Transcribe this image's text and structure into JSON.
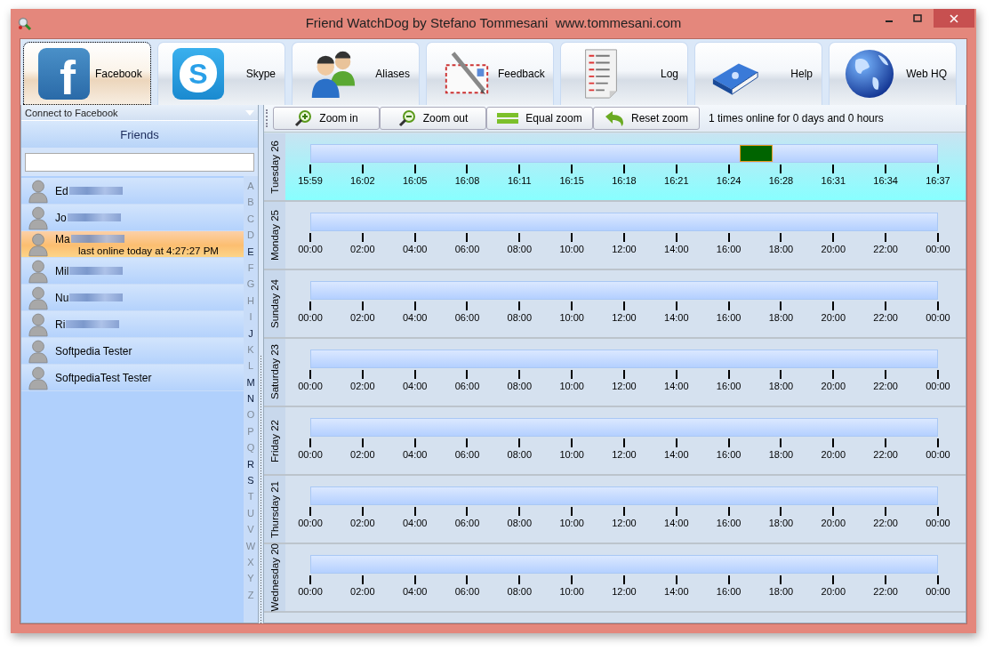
{
  "window": {
    "title": "Friend WatchDog by Stefano Tommesani  www.tommesani.com"
  },
  "tabs": [
    {
      "label": "Facebook",
      "kind": "facebook",
      "glyph": "f",
      "selected": true
    },
    {
      "label": "Skype",
      "kind": "skype",
      "glyph": "S",
      "selected": false
    },
    {
      "label": "Aliases",
      "kind": "people",
      "selected": false
    },
    {
      "label": "Feedback",
      "kind": "letter",
      "selected": false
    },
    {
      "label": "Log",
      "kind": "log",
      "selected": false
    },
    {
      "label": "Help",
      "kind": "book",
      "selected": false
    },
    {
      "label": "Web HQ",
      "kind": "globe",
      "selected": false
    }
  ],
  "left_panel": {
    "connect": "Connect to Facebook",
    "header": "Friends",
    "friends": [
      {
        "name": "Ed",
        "redacted": true,
        "selected": false
      },
      {
        "name": "Jo",
        "redacted": true,
        "selected": false
      },
      {
        "name": "Ma",
        "redacted": true,
        "selected": true,
        "status": "last online today at 4:27:27 PM"
      },
      {
        "name": "Mil",
        "redacted": true,
        "selected": false
      },
      {
        "name": "Nu",
        "redacted": true,
        "selected": false
      },
      {
        "name": "Ri",
        "redacted": true,
        "selected": false
      },
      {
        "name": "Softpedia Tester",
        "redacted": false,
        "selected": false
      },
      {
        "name": "SoftpediaTest Tester",
        "redacted": false,
        "selected": false
      }
    ],
    "index": [
      {
        "letter": "A",
        "active": false
      },
      {
        "letter": "B",
        "active": false
      },
      {
        "letter": "C",
        "active": false
      },
      {
        "letter": "D",
        "active": false
      },
      {
        "letter": "E",
        "active": true
      },
      {
        "letter": "F",
        "active": false
      },
      {
        "letter": "G",
        "active": false
      },
      {
        "letter": "H",
        "active": false
      },
      {
        "letter": "I",
        "active": false
      },
      {
        "letter": "J",
        "active": true
      },
      {
        "letter": "K",
        "active": false
      },
      {
        "letter": "L",
        "active": false
      },
      {
        "letter": "M",
        "active": true
      },
      {
        "letter": "N",
        "active": true
      },
      {
        "letter": "O",
        "active": false
      },
      {
        "letter": "P",
        "active": false
      },
      {
        "letter": "Q",
        "active": false
      },
      {
        "letter": "R",
        "active": true
      },
      {
        "letter": "S",
        "active": true
      },
      {
        "letter": "T",
        "active": false
      },
      {
        "letter": "U",
        "active": false
      },
      {
        "letter": "V",
        "active": false
      },
      {
        "letter": "W",
        "active": false
      },
      {
        "letter": "X",
        "active": false
      },
      {
        "letter": "Y",
        "active": false
      },
      {
        "letter": "Z",
        "active": false
      }
    ]
  },
  "zoom_toolbar": {
    "buttons": [
      {
        "label": "Zoom in",
        "kind": "zoom-in"
      },
      {
        "label": "Zoom out",
        "kind": "zoom-out"
      },
      {
        "label": "Equal zoom",
        "kind": "equal"
      },
      {
        "label": "Reset zoom",
        "kind": "reset"
      }
    ],
    "summary": "1 times online for 0 days and 0 hours"
  },
  "days": [
    {
      "label": "Tuesday 26",
      "selected": true,
      "ticks": [
        "15:59",
        "16:02",
        "16:05",
        "16:08",
        "16:11",
        "16:15",
        "16:18",
        "16:21",
        "16:24",
        "16:28",
        "16:31",
        "16:34",
        "16:37"
      ],
      "online": [
        {
          "start": {
            "level": 0.684
          },
          "end": {
            "level": 0.737
          }
        }
      ]
    },
    {
      "label": "Monday 25",
      "selected": false,
      "ticks": [
        "00:00",
        "02:00",
        "04:00",
        "06:00",
        "08:00",
        "10:00",
        "12:00",
        "14:00",
        "16:00",
        "18:00",
        "20:00",
        "22:00",
        "00:00"
      ]
    },
    {
      "label": "Sunday 24",
      "selected": false,
      "ticks": [
        "00:00",
        "02:00",
        "04:00",
        "06:00",
        "08:00",
        "10:00",
        "12:00",
        "14:00",
        "16:00",
        "18:00",
        "20:00",
        "22:00",
        "00:00"
      ]
    },
    {
      "label": "Saturday 23",
      "selected": false,
      "ticks": [
        "00:00",
        "02:00",
        "04:00",
        "06:00",
        "08:00",
        "10:00",
        "12:00",
        "14:00",
        "16:00",
        "18:00",
        "20:00",
        "22:00",
        "00:00"
      ]
    },
    {
      "label": "Friday 22",
      "selected": false,
      "ticks": [
        "00:00",
        "02:00",
        "04:00",
        "06:00",
        "08:00",
        "10:00",
        "12:00",
        "14:00",
        "16:00",
        "18:00",
        "20:00",
        "22:00",
        "00:00"
      ]
    },
    {
      "label": "Thursday 21",
      "selected": false,
      "ticks": [
        "00:00",
        "02:00",
        "04:00",
        "06:00",
        "08:00",
        "10:00",
        "12:00",
        "14:00",
        "16:00",
        "18:00",
        "20:00",
        "22:00",
        "00:00"
      ]
    },
    {
      "label": "Wednesday 20",
      "selected": false,
      "ticks": [
        "00:00",
        "02:00",
        "04:00",
        "06:00",
        "08:00",
        "10:00",
        "12:00",
        "14:00",
        "16:00",
        "18:00",
        "20:00",
        "22:00",
        "00:00"
      ]
    }
  ]
}
